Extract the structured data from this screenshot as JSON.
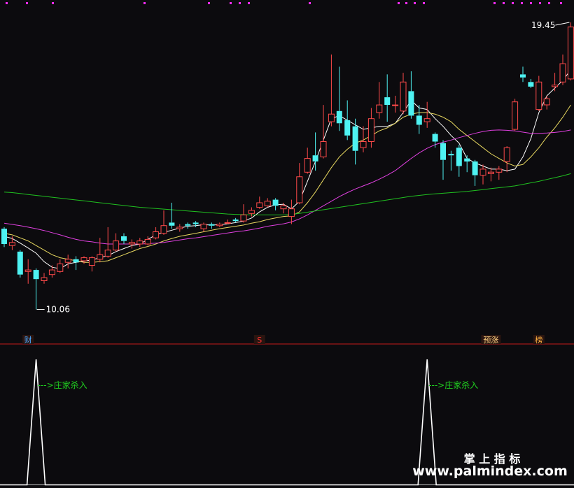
{
  "chart_data": [
    {
      "type": "candlestick",
      "price_labels": {
        "high": "19.45",
        "low": "10.06"
      },
      "high_value": 19.45,
      "low_value": 10.06,
      "ylim": [
        9.5,
        20.0
      ],
      "markers": [
        {
          "text": "财",
          "index": 3,
          "color": "#4aa8ff"
        },
        {
          "text": "S",
          "index": 32,
          "color": "#ff3030"
        },
        {
          "text": "预涨",
          "index": 61,
          "color": "#ffd080"
        },
        {
          "text": "榜",
          "index": 67,
          "color": "#ffb040"
        }
      ],
      "candles": [
        [
          12.7,
          12.2,
          12.75,
          12.1
        ],
        [
          12.15,
          12.25,
          12.45,
          12.0
        ],
        [
          11.95,
          11.2,
          12.0,
          11.1
        ],
        [
          11.3,
          11.35,
          11.7,
          10.9
        ],
        [
          11.35,
          11.05,
          11.4,
          10.06
        ],
        [
          11.0,
          11.1,
          11.25,
          10.9
        ],
        [
          11.2,
          11.35,
          11.5,
          11.1
        ],
        [
          11.3,
          11.55,
          11.7,
          11.25
        ],
        [
          11.6,
          11.7,
          11.85,
          11.4
        ],
        [
          11.7,
          11.6,
          11.8,
          11.35
        ],
        [
          11.65,
          11.75,
          11.8,
          11.55
        ],
        [
          11.5,
          11.75,
          11.8,
          11.3
        ],
        [
          11.7,
          11.85,
          12.4,
          11.6
        ],
        [
          11.8,
          12.0,
          12.75,
          11.75
        ],
        [
          12.0,
          12.3,
          12.55,
          11.95
        ],
        [
          12.45,
          12.3,
          12.55,
          12.2
        ],
        [
          12.2,
          12.25,
          12.35,
          12.05
        ],
        [
          12.2,
          12.3,
          12.4,
          12.1
        ],
        [
          12.2,
          12.35,
          12.45,
          12.15
        ],
        [
          12.4,
          12.6,
          12.75,
          12.35
        ],
        [
          12.55,
          12.8,
          13.3,
          12.5
        ],
        [
          12.9,
          12.8,
          13.55,
          12.7
        ],
        [
          12.7,
          12.75,
          12.85,
          12.6
        ],
        [
          12.85,
          12.8,
          12.9,
          12.7
        ],
        [
          12.9,
          12.85,
          12.95,
          12.75
        ],
        [
          12.7,
          12.85,
          12.9,
          12.6
        ],
        [
          12.85,
          12.8,
          12.9,
          12.7
        ],
        [
          12.8,
          12.85,
          12.9,
          12.75
        ],
        [
          12.9,
          12.9,
          13.0,
          12.85
        ],
        [
          13.0,
          12.95,
          13.05,
          12.9
        ],
        [
          12.95,
          13.15,
          13.5,
          12.9
        ],
        [
          13.2,
          13.3,
          13.4,
          13.1
        ],
        [
          13.4,
          13.55,
          13.75,
          13.35
        ],
        [
          13.45,
          13.6,
          13.7,
          13.4
        ],
        [
          13.65,
          13.45,
          13.7,
          13.3
        ],
        [
          13.35,
          13.45,
          13.55,
          13.2
        ],
        [
          13.1,
          13.35,
          13.65,
          12.85
        ],
        [
          13.55,
          14.4,
          14.85,
          13.5
        ],
        [
          14.55,
          15.0,
          15.35,
          14.5
        ],
        [
          15.1,
          14.9,
          15.85,
          14.6
        ],
        [
          15.05,
          15.55,
          16.75,
          15.0
        ],
        [
          16.2,
          16.45,
          18.4,
          16.05
        ],
        [
          16.55,
          16.15,
          18.0,
          15.9
        ],
        [
          16.25,
          15.75,
          16.9,
          15.6
        ],
        [
          16.05,
          15.25,
          16.3,
          14.8
        ],
        [
          15.35,
          15.55,
          16.05,
          15.2
        ],
        [
          15.55,
          16.3,
          16.65,
          15.35
        ],
        [
          16.5,
          16.75,
          17.5,
          16.3
        ],
        [
          17.0,
          16.75,
          17.75,
          16.2
        ],
        [
          16.75,
          16.75,
          17.05,
          16.5
        ],
        [
          16.55,
          17.5,
          17.8,
          16.45
        ],
        [
          17.2,
          16.4,
          17.85,
          16.3
        ],
        [
          16.4,
          16.1,
          16.75,
          15.8
        ],
        [
          16.2,
          16.3,
          16.85,
          16.0
        ],
        [
          15.8,
          15.55,
          15.85,
          15.35
        ],
        [
          15.5,
          14.95,
          15.6,
          14.3
        ],
        [
          15.15,
          15.1,
          15.25,
          14.6
        ],
        [
          15.35,
          14.75,
          15.45,
          14.4
        ],
        [
          15.0,
          14.9,
          15.1,
          14.55
        ],
        [
          14.9,
          14.45,
          14.95,
          14.1
        ],
        [
          14.45,
          14.65,
          14.8,
          14.15
        ],
        [
          14.5,
          14.55,
          14.7,
          14.25
        ],
        [
          14.55,
          14.65,
          14.75,
          14.3
        ],
        [
          14.9,
          15.35,
          15.4,
          14.55
        ],
        [
          15.95,
          16.85,
          16.95,
          15.9
        ],
        [
          17.75,
          17.65,
          18.0,
          17.5
        ],
        [
          17.5,
          17.35,
          17.6,
          17.3
        ],
        [
          16.6,
          17.5,
          17.7,
          16.55
        ],
        [
          16.75,
          16.95,
          17.05,
          16.6
        ],
        [
          17.35,
          17.4,
          17.8,
          17.2
        ],
        [
          17.5,
          18.1,
          18.4,
          17.4
        ],
        [
          17.6,
          19.3,
          19.45,
          17.55
        ]
      ],
      "moving_averages": [
        {
          "color": "#ffffff",
          "values": [
            12.45,
            12.38,
            12.23,
            12.07,
            11.9,
            11.62,
            11.44,
            11.39,
            11.55,
            11.6,
            11.64,
            11.68,
            11.75,
            11.82,
            11.95,
            12.05,
            12.15,
            12.2,
            12.35,
            12.5,
            12.58,
            12.65,
            12.72,
            12.78,
            12.8,
            12.83,
            12.82,
            12.83,
            12.86,
            12.9,
            12.95,
            13.05,
            13.25,
            13.4,
            13.48,
            13.5,
            13.35,
            13.6,
            14.25,
            14.9,
            15.6,
            16.3,
            16.4,
            16.25,
            16.1,
            15.95,
            16.0,
            16.05,
            16.05,
            16.15,
            16.5,
            16.9,
            16.65,
            16.6,
            16.3,
            16.05,
            15.75,
            15.5,
            15.0,
            14.85,
            14.75,
            14.65,
            14.65,
            14.6,
            14.65,
            15.05,
            15.65,
            16.5,
            17.05,
            17.3,
            17.55,
            17.9
          ]
        },
        {
          "color": "#e8d860",
          "values": [
            12.55,
            12.5,
            12.4,
            12.3,
            12.15,
            12.0,
            11.85,
            11.75,
            11.7,
            11.65,
            11.6,
            11.6,
            11.62,
            11.65,
            11.75,
            11.85,
            11.95,
            12.05,
            12.12,
            12.2,
            12.3,
            12.38,
            12.45,
            12.5,
            12.55,
            12.6,
            12.65,
            12.7,
            12.74,
            12.78,
            12.82,
            12.88,
            12.93,
            13.0,
            13.05,
            13.1,
            13.12,
            13.25,
            13.55,
            13.9,
            14.3,
            14.7,
            15.05,
            15.3,
            15.5,
            15.6,
            15.75,
            15.9,
            16.0,
            16.15,
            16.35,
            16.45,
            16.5,
            16.5,
            16.45,
            16.35,
            16.2,
            15.95,
            15.75,
            15.55,
            15.35,
            15.15,
            15.0,
            14.85,
            14.75,
            14.8,
            15.05,
            15.35,
            15.7,
            16.0,
            16.35,
            16.75
          ]
        },
        {
          "color": "#e040e0",
          "values": [
            12.88,
            12.84,
            12.8,
            12.75,
            12.7,
            12.64,
            12.57,
            12.5,
            12.42,
            12.35,
            12.3,
            12.27,
            12.23,
            12.2,
            12.2,
            12.2,
            12.2,
            12.2,
            12.21,
            12.23,
            12.25,
            12.29,
            12.33,
            12.37,
            12.4,
            12.44,
            12.48,
            12.52,
            12.56,
            12.6,
            12.63,
            12.67,
            12.72,
            12.78,
            12.82,
            12.86,
            12.92,
            13.02,
            13.15,
            13.3,
            13.45,
            13.6,
            13.75,
            13.88,
            14.0,
            14.1,
            14.2,
            14.32,
            14.45,
            14.6,
            14.8,
            15.0,
            15.18,
            15.33,
            15.45,
            15.53,
            15.6,
            15.68,
            15.75,
            15.82,
            15.88,
            15.92,
            15.93,
            15.92,
            15.9,
            15.86,
            15.82,
            15.82,
            15.83,
            15.85,
            15.88,
            15.93
          ]
        },
        {
          "color": "#20c020",
          "values": [
            13.9,
            13.88,
            13.85,
            13.82,
            13.79,
            13.76,
            13.73,
            13.7,
            13.67,
            13.64,
            13.61,
            13.58,
            13.55,
            13.52,
            13.49,
            13.46,
            13.43,
            13.4,
            13.38,
            13.36,
            13.34,
            13.32,
            13.3,
            13.28,
            13.26,
            13.24,
            13.22,
            13.2,
            13.18,
            13.17,
            13.16,
            13.15,
            13.15,
            13.15,
            13.15,
            13.15,
            13.17,
            13.2,
            13.24,
            13.28,
            13.32,
            13.36,
            13.4,
            13.44,
            13.48,
            13.52,
            13.56,
            13.6,
            13.64,
            13.68,
            13.72,
            13.76,
            13.79,
            13.82,
            13.84,
            13.86,
            13.88,
            13.9,
            13.92,
            13.95,
            13.98,
            14.01,
            14.04,
            14.07,
            14.1,
            14.15,
            14.2,
            14.25,
            14.31,
            14.37,
            14.43,
            14.5
          ]
        }
      ]
    },
    {
      "type": "line",
      "annotations": [
        {
          "text": "--->庄家杀入",
          "index": 4,
          "color": "#20d020"
        },
        {
          "text": "--->庄家杀入",
          "index": 53,
          "color": "#20d020"
        }
      ],
      "spike_indices": [
        4,
        53
      ]
    }
  ],
  "watermark": {
    "line1": "掌 上 指 标",
    "line2": "www.palmindex.com"
  }
}
